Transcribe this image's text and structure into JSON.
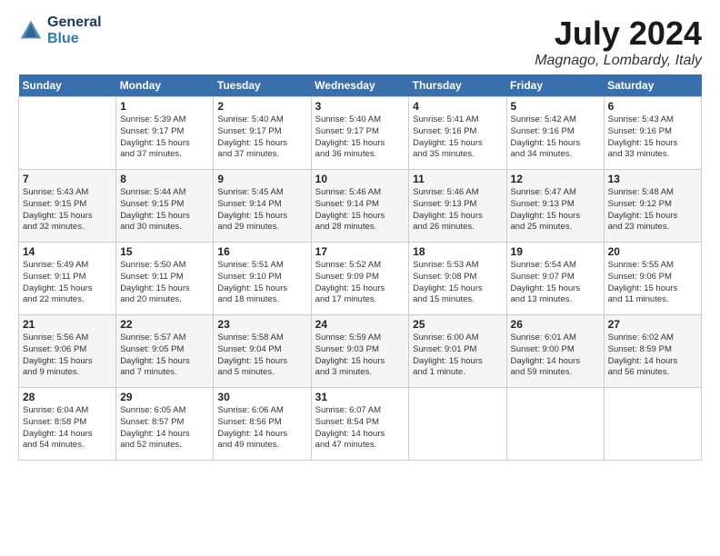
{
  "header": {
    "logo_line1": "General",
    "logo_line2": "Blue",
    "title": "July 2024",
    "subtitle": "Magnago, Lombardy, Italy"
  },
  "calendar": {
    "days_of_week": [
      "Sunday",
      "Monday",
      "Tuesday",
      "Wednesday",
      "Thursday",
      "Friday",
      "Saturday"
    ],
    "weeks": [
      [
        {
          "day": "",
          "info": ""
        },
        {
          "day": "1",
          "info": "Sunrise: 5:39 AM\nSunset: 9:17 PM\nDaylight: 15 hours\nand 37 minutes."
        },
        {
          "day": "2",
          "info": "Sunrise: 5:40 AM\nSunset: 9:17 PM\nDaylight: 15 hours\nand 37 minutes."
        },
        {
          "day": "3",
          "info": "Sunrise: 5:40 AM\nSunset: 9:17 PM\nDaylight: 15 hours\nand 36 minutes."
        },
        {
          "day": "4",
          "info": "Sunrise: 5:41 AM\nSunset: 9:16 PM\nDaylight: 15 hours\nand 35 minutes."
        },
        {
          "day": "5",
          "info": "Sunrise: 5:42 AM\nSunset: 9:16 PM\nDaylight: 15 hours\nand 34 minutes."
        },
        {
          "day": "6",
          "info": "Sunrise: 5:43 AM\nSunset: 9:16 PM\nDaylight: 15 hours\nand 33 minutes."
        }
      ],
      [
        {
          "day": "7",
          "info": "Sunrise: 5:43 AM\nSunset: 9:15 PM\nDaylight: 15 hours\nand 32 minutes."
        },
        {
          "day": "8",
          "info": "Sunrise: 5:44 AM\nSunset: 9:15 PM\nDaylight: 15 hours\nand 30 minutes."
        },
        {
          "day": "9",
          "info": "Sunrise: 5:45 AM\nSunset: 9:14 PM\nDaylight: 15 hours\nand 29 minutes."
        },
        {
          "day": "10",
          "info": "Sunrise: 5:46 AM\nSunset: 9:14 PM\nDaylight: 15 hours\nand 28 minutes."
        },
        {
          "day": "11",
          "info": "Sunrise: 5:46 AM\nSunset: 9:13 PM\nDaylight: 15 hours\nand 26 minutes."
        },
        {
          "day": "12",
          "info": "Sunrise: 5:47 AM\nSunset: 9:13 PM\nDaylight: 15 hours\nand 25 minutes."
        },
        {
          "day": "13",
          "info": "Sunrise: 5:48 AM\nSunset: 9:12 PM\nDaylight: 15 hours\nand 23 minutes."
        }
      ],
      [
        {
          "day": "14",
          "info": "Sunrise: 5:49 AM\nSunset: 9:11 PM\nDaylight: 15 hours\nand 22 minutes."
        },
        {
          "day": "15",
          "info": "Sunrise: 5:50 AM\nSunset: 9:11 PM\nDaylight: 15 hours\nand 20 minutes."
        },
        {
          "day": "16",
          "info": "Sunrise: 5:51 AM\nSunset: 9:10 PM\nDaylight: 15 hours\nand 18 minutes."
        },
        {
          "day": "17",
          "info": "Sunrise: 5:52 AM\nSunset: 9:09 PM\nDaylight: 15 hours\nand 17 minutes."
        },
        {
          "day": "18",
          "info": "Sunrise: 5:53 AM\nSunset: 9:08 PM\nDaylight: 15 hours\nand 15 minutes."
        },
        {
          "day": "19",
          "info": "Sunrise: 5:54 AM\nSunset: 9:07 PM\nDaylight: 15 hours\nand 13 minutes."
        },
        {
          "day": "20",
          "info": "Sunrise: 5:55 AM\nSunset: 9:06 PM\nDaylight: 15 hours\nand 11 minutes."
        }
      ],
      [
        {
          "day": "21",
          "info": "Sunrise: 5:56 AM\nSunset: 9:06 PM\nDaylight: 15 hours\nand 9 minutes."
        },
        {
          "day": "22",
          "info": "Sunrise: 5:57 AM\nSunset: 9:05 PM\nDaylight: 15 hours\nand 7 minutes."
        },
        {
          "day": "23",
          "info": "Sunrise: 5:58 AM\nSunset: 9:04 PM\nDaylight: 15 hours\nand 5 minutes."
        },
        {
          "day": "24",
          "info": "Sunrise: 5:59 AM\nSunset: 9:03 PM\nDaylight: 15 hours\nand 3 minutes."
        },
        {
          "day": "25",
          "info": "Sunrise: 6:00 AM\nSunset: 9:01 PM\nDaylight: 15 hours\nand 1 minute."
        },
        {
          "day": "26",
          "info": "Sunrise: 6:01 AM\nSunset: 9:00 PM\nDaylight: 14 hours\nand 59 minutes."
        },
        {
          "day": "27",
          "info": "Sunrise: 6:02 AM\nSunset: 8:59 PM\nDaylight: 14 hours\nand 56 minutes."
        }
      ],
      [
        {
          "day": "28",
          "info": "Sunrise: 6:04 AM\nSunset: 8:58 PM\nDaylight: 14 hours\nand 54 minutes."
        },
        {
          "day": "29",
          "info": "Sunrise: 6:05 AM\nSunset: 8:57 PM\nDaylight: 14 hours\nand 52 minutes."
        },
        {
          "day": "30",
          "info": "Sunrise: 6:06 AM\nSunset: 8:56 PM\nDaylight: 14 hours\nand 49 minutes."
        },
        {
          "day": "31",
          "info": "Sunrise: 6:07 AM\nSunset: 8:54 PM\nDaylight: 14 hours\nand 47 minutes."
        },
        {
          "day": "",
          "info": ""
        },
        {
          "day": "",
          "info": ""
        },
        {
          "day": "",
          "info": ""
        }
      ]
    ]
  }
}
